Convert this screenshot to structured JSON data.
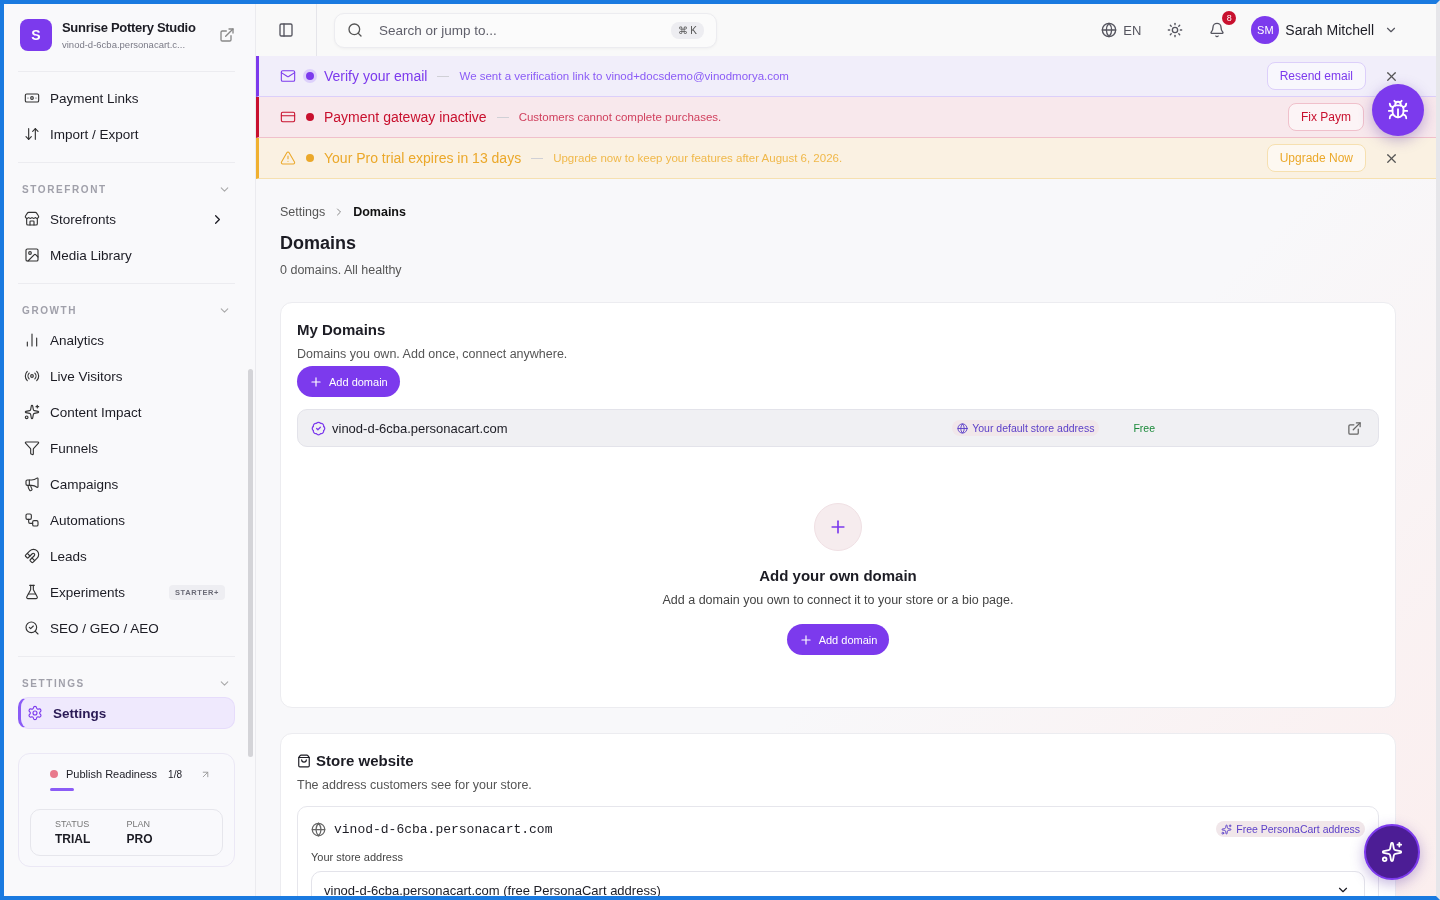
{
  "sidebar": {
    "brand": {
      "initial": "S",
      "name": "Sunrise Pottery Studio",
      "url": "vinod-d-6cba.personacart.c..."
    },
    "sections": [
      {
        "items": [
          {
            "label": "Payment Links",
            "selected": false
          },
          {
            "label": "Import / Export",
            "selected": false
          }
        ]
      },
      {
        "title": "STOREFRONT",
        "expanded": true,
        "items": [
          {
            "label": "Storefronts",
            "selected": false,
            "has_submenu": true
          },
          {
            "label": "Media Library",
            "selected": false
          }
        ]
      },
      {
        "title": "GROWTH",
        "expanded": true,
        "items": [
          {
            "label": "Analytics",
            "selected": false
          },
          {
            "label": "Live Visitors",
            "selected": false
          },
          {
            "label": "Content Impact",
            "selected": false
          },
          {
            "label": "Funnels",
            "selected": false
          },
          {
            "label": "Campaigns",
            "selected": false
          },
          {
            "label": "Automations",
            "selected": false
          },
          {
            "label": "Leads",
            "selected": false
          },
          {
            "label": "Experiments",
            "selected": false,
            "badge": "STARTER+"
          },
          {
            "label": "SEO / GEO / AEO",
            "selected": false
          }
        ]
      },
      {
        "title": "SETTINGS",
        "expanded": true,
        "items": [
          {
            "label": "Settings",
            "selected": true
          }
        ]
      }
    ],
    "readiness": {
      "label": "Publish Readiness",
      "count": "1/8",
      "level": 0.125,
      "status_label": "STATUS",
      "status": "TRIAL",
      "plan_label": "PLAN",
      "plan": "PRO"
    }
  },
  "topbar": {
    "search": {
      "placeholder": "Search or jump to...",
      "shortcut": "⌘ K"
    },
    "language": "EN",
    "notifications": "8",
    "user": {
      "initials": "SM",
      "name": "Sarah Mitchell"
    }
  },
  "banners": [
    {
      "kind": "info",
      "title": "Verify your email",
      "message": "We sent a verification link to vinod+docsdemo@vinodmorya.com",
      "action": "Resend email",
      "dismissible": true
    },
    {
      "kind": "error",
      "title": "Payment gateway inactive",
      "message": "Customers cannot complete purchases.",
      "action": "Fix Paym",
      "dismissible": false
    },
    {
      "kind": "warning",
      "title": "Your Pro trial expires in 13 days",
      "message": "Upgrade now to keep your features after August 6, 2026.",
      "action": "Upgrade Now",
      "dismissible": true
    }
  ],
  "breadcrumb": [
    "Settings",
    "Domains"
  ],
  "page": {
    "title": "Domains",
    "subtitle": "0 domains. All healthy"
  },
  "my_domains": {
    "title": "My Domains",
    "description": "Domains you own. Add once, connect anywhere.",
    "add_button": "Add domain",
    "domains": [
      {
        "name": "vinod-d-6cba.personacart.com",
        "tag": "Your default store address",
        "plan": "Free"
      }
    ],
    "empty_state": {
      "title": "Add your own domain",
      "message": "Add a domain you own to connect it to your store or a bio page.",
      "button": "Add domain"
    }
  },
  "store_website": {
    "title": "Store website",
    "description": "The address customers see for your store.",
    "domain": "vinod-d-6cba.personacart.com",
    "tag": "Free PersonaCart address",
    "field_label": "Your store address",
    "select_value": "vinod-d-6cba.personacart.com (free PersonaCart address)"
  }
}
